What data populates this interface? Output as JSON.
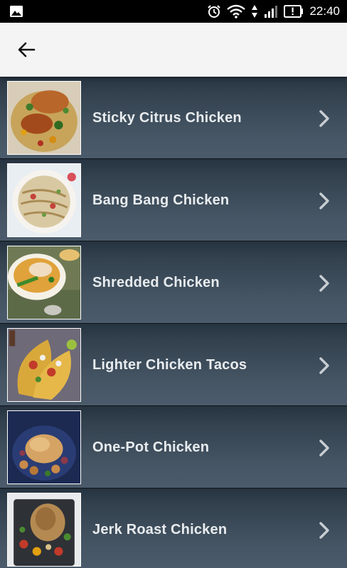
{
  "status_bar": {
    "time": "22:40"
  },
  "app_bar": {
    "back_icon": "arrow-left-icon"
  },
  "recipes": [
    {
      "title": "Sticky Citrus Chicken"
    },
    {
      "title": "Bang Bang Chicken"
    },
    {
      "title": "Shredded Chicken"
    },
    {
      "title": "Lighter Chicken Tacos"
    },
    {
      "title": "One-Pot Chicken"
    },
    {
      "title": "Jerk Roast Chicken"
    }
  ],
  "colors": {
    "status_bar": "#000000",
    "app_bar": "#f4f4f4",
    "list_background": "#3a4a58",
    "label": "#e8ecef",
    "chevron": "#c9ced3"
  }
}
